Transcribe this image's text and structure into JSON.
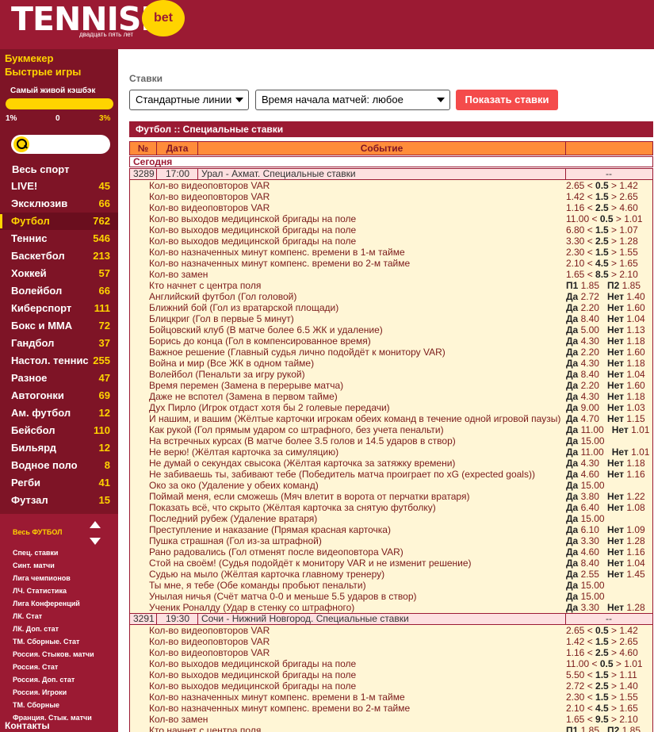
{
  "header": {
    "logo": "TENNISI",
    "logo_badge": "bet",
    "tagline": "двадцать пять лет"
  },
  "sidebar": {
    "links": [
      "Букмекер",
      "Быстрые игры"
    ],
    "cashback": {
      "title": "Самый живой кэшбэк",
      "min": "1%",
      "mid": "0",
      "max": "3%"
    },
    "search": {
      "placeholder": ""
    },
    "all_sport": "Весь спорт",
    "sports": [
      {
        "name": "LIVE!",
        "count": "45"
      },
      {
        "name": "Эксклюзив",
        "count": "66"
      },
      {
        "name": "Футбол",
        "count": "762",
        "active": true
      },
      {
        "name": "Теннис",
        "count": "546"
      },
      {
        "name": "Баскетбол",
        "count": "213"
      },
      {
        "name": "Хоккей",
        "count": "57"
      },
      {
        "name": "Волейбол",
        "count": "66"
      },
      {
        "name": "Киберспорт",
        "count": "111"
      },
      {
        "name": "Бокс и ММА",
        "count": "72"
      },
      {
        "name": "Гандбол",
        "count": "37"
      },
      {
        "name": "Настол. теннис",
        "count": "255"
      },
      {
        "name": "Разное",
        "count": "47"
      },
      {
        "name": "Автогонки",
        "count": "69"
      },
      {
        "name": "Ам. футбол",
        "count": "12"
      },
      {
        "name": "Бейсбол",
        "count": "110"
      },
      {
        "name": "Бильярд",
        "count": "12"
      },
      {
        "name": "Водное поло",
        "count": "8"
      },
      {
        "name": "Регби",
        "count": "41"
      },
      {
        "name": "Футзал",
        "count": "15"
      }
    ],
    "sub_title": "Весь ФУТБОЛ",
    "sub_items": [
      "Спец. ставки",
      "Синт. матчи",
      "Лига чемпионов",
      "ЛЧ. Статистика",
      "Лига Конференций",
      "ЛК. Стат",
      "ЛК. Доп. стат",
      "ТМ. Сборные. Стат",
      "Россия. Стыков. матчи",
      "Россия. Стат",
      "Россия. Доп. стат",
      "Россия. Игроки",
      "ТМ. Сборные",
      "Франция. Стык. матчи"
    ],
    "contacts": "Контакты"
  },
  "main": {
    "label": "Ставки",
    "select_lines": "Стандартные линии",
    "select_time": "Время начала матчей: любое",
    "show_button": "Показать ставки",
    "section_title": "Футбол :: Специальные ставки",
    "columns": [
      "№",
      "Дата",
      "Событие"
    ],
    "today": "Сегодня",
    "matches": [
      {
        "id": "3289",
        "time": "17:00",
        "title": "Урал - Ахмат. Специальные ставки",
        "dash": "--",
        "rows": [
          {
            "e": "Кол-во видеоповторов VAR",
            "o": "2.65 < <b>0.5</b> > 1.42"
          },
          {
            "e": "Кол-во видеоповторов VAR",
            "o": "1.42 < <b>1.5</b> > 2.65"
          },
          {
            "e": "Кол-во видеоповторов VAR",
            "o": "1.16 < <b>2.5</b> > 4.60"
          },
          {
            "e": "Кол-во выходов медицинской бригады на поле",
            "o": "11.00 < <b>0.5</b> > 1.01"
          },
          {
            "e": "Кол-во выходов медицинской бригады на поле",
            "o": "6.80 < <b>1.5</b> > 1.07"
          },
          {
            "e": "Кол-во выходов медицинской бригады на поле",
            "o": "3.30 < <b>2.5</b> > 1.28"
          },
          {
            "e": "Кол-во назначенных минут компенс. времени в 1-м тайме",
            "o": "2.30 < <b>1.5</b> > 1.55"
          },
          {
            "e": "Кол-во назначенных минут компенс. времени во 2-м тайме",
            "o": "2.10 < <b>4.5</b> > 1.65"
          },
          {
            "e": "Кол-во замен",
            "o": "1.65 < <b>8.5</b> > 2.10"
          },
          {
            "e": "Кто начнет с центра поля",
            "o": "<b>П1</b> 1.85 &nbsp;&nbsp;<b>П2</b> 1.85"
          },
          {
            "e": "Английский футбол (Гол головой)",
            "o": "<b>Да</b> 2.72 &nbsp;&nbsp;<b>Нет</b> 1.40"
          },
          {
            "e": "Ближний бой (Гол из вратарской площади)",
            "o": "<b>Да</b> 2.20 &nbsp;&nbsp;<b>Нет</b> 1.60"
          },
          {
            "e": "Блицкриг (Гол в первые 5 минут)",
            "o": "<b>Да</b> 8.40 &nbsp;&nbsp;<b>Нет</b> 1.04"
          },
          {
            "e": "Бойцовский клуб (В матче более 6.5 ЖК и удаление)",
            "o": "<b>Да</b> 5.00 &nbsp;&nbsp;<b>Нет</b> 1.13"
          },
          {
            "e": "Борись до конца (Гол в компенсированное время)",
            "o": "<b>Да</b> 4.30 &nbsp;&nbsp;<b>Нет</b> 1.18"
          },
          {
            "e": "Важное решение (Главный судья лично подойдёт к монитору VAR)",
            "o": "<b>Да</b> 2.20 &nbsp;&nbsp;<b>Нет</b> 1.60"
          },
          {
            "e": "Война и мир (Все ЖК в одном тайме)",
            "o": "<b>Да</b> 4.30 &nbsp;&nbsp;<b>Нет</b> 1.18"
          },
          {
            "e": "Волейбол (Пенальти за игру рукой)",
            "o": "<b>Да</b> 8.40 &nbsp;&nbsp;<b>Нет</b> 1.04"
          },
          {
            "e": "Время перемен (Замена в перерыве матча)",
            "o": "<b>Да</b> 2.20 &nbsp;&nbsp;<b>Нет</b> 1.60"
          },
          {
            "e": "Даже не вспотел (Замена в первом тайме)",
            "o": "<b>Да</b> 4.30 &nbsp;&nbsp;<b>Нет</b> 1.18"
          },
          {
            "e": "Дух Пирло (Игрок отдаст хотя бы 2 голевые передачи)",
            "o": "<b>Да</b> 9.00 &nbsp;&nbsp;<b>Нет</b> 1.03"
          },
          {
            "e": "И нашим, и вашим (Жёлтые карточки игрокам обеих команд в течение одной игровой паузы)",
            "o": "<b>Да</b> 4.70 &nbsp;&nbsp;<b>Нет</b> 1.15"
          },
          {
            "e": "Как рукой (Гол прямым ударом со штрафного, без учета пенальти)",
            "o": "<b>Да</b> 11.00 &nbsp;&nbsp;<b>Нет</b> 1.01"
          },
          {
            "e": "На встречных курсах (В матче более 3.5 голов и 14.5 ударов в створ)",
            "o": "<b>Да</b> 15.00"
          },
          {
            "e": "Не верю! (Жёлтая карточка за симуляцию)",
            "o": "<b>Да</b> 11.00 &nbsp;&nbsp;<b>Нет</b> 1.01"
          },
          {
            "e": "Не думай о секундах свысока (Жёлтая карточка за затяжку времени)",
            "o": "<b>Да</b> 4.30 &nbsp;&nbsp;<b>Нет</b> 1.18"
          },
          {
            "e": "Не забиваешь ты, забивают тебе (Победитель матча проиграет по xG (expected goals))",
            "o": "<b>Да</b> 4.60 &nbsp;&nbsp;<b>Нет</b> 1.16"
          },
          {
            "e": "Око за око (Удаление у обеих команд)",
            "o": "<b>Да</b> 15.00"
          },
          {
            "e": "Поймай меня, если сможешь (Мяч влетит в ворота от перчатки вратаря)",
            "o": "<b>Да</b> 3.80 &nbsp;&nbsp;<b>Нет</b> 1.22"
          },
          {
            "e": "Показать всё, что скрыто (Жёлтая карточка за снятую футболку)",
            "o": "<b>Да</b> 6.40 &nbsp;&nbsp;<b>Нет</b> 1.08"
          },
          {
            "e": "Последний рубеж (Удаление вратаря)",
            "o": "<b>Да</b> 15.00"
          },
          {
            "e": "Преступление и наказание (Прямая красная карточка)",
            "o": "<b>Да</b> 6.10 &nbsp;&nbsp;<b>Нет</b> 1.09"
          },
          {
            "e": "Пушка страшная (Гол из-за штрафной)",
            "o": "<b>Да</b> 3.30 &nbsp;&nbsp;<b>Нет</b> 1.28"
          },
          {
            "e": "Рано радовались (Гол отменят после видеоповтора VAR)",
            "o": "<b>Да</b> 4.60 &nbsp;&nbsp;<b>Нет</b> 1.16"
          },
          {
            "e": "Стой на своём! (Судья подойдёт к монитору VAR и не изменит решение)",
            "o": "<b>Да</b> 8.40 &nbsp;&nbsp;<b>Нет</b> 1.04"
          },
          {
            "e": "Судью на мыло (Жёлтая карточка главному тренеру)",
            "o": "<b>Да</b> 2.55 &nbsp;&nbsp;<b>Нет</b> 1.45"
          },
          {
            "e": "Ты мне, я тебе (Обе команды пробьют пенальти)",
            "o": "<b>Да</b> 15.00"
          },
          {
            "e": "Унылая ничья (Счёт матча 0-0 и меньше 5.5 ударов в створ)",
            "o": "<b>Да</b> 15.00"
          },
          {
            "e": "Ученик Роналду (Удар в стенку со штрафного)",
            "o": "<b>Да</b> 3.30 &nbsp;&nbsp;<b>Нет</b> 1.28"
          }
        ]
      },
      {
        "id": "3291",
        "time": "19:30",
        "title": "Сочи - Нижний Новгород. Специальные ставки",
        "dash": "--",
        "rows": [
          {
            "e": "Кол-во видеоповторов VAR",
            "o": "2.65 < <b>0.5</b> > 1.42"
          },
          {
            "e": "Кол-во видеоповторов VAR",
            "o": "1.42 < <b>1.5</b> > 2.65"
          },
          {
            "e": "Кол-во видеоповторов VAR",
            "o": "1.16 < <b>2.5</b> > 4.60"
          },
          {
            "e": "Кол-во выходов медицинской бригады на поле",
            "o": "11.00 < <b>0.5</b> > 1.01"
          },
          {
            "e": "Кол-во выходов медицинской бригады на поле",
            "o": "5.50 < <b>1.5</b> > 1.11"
          },
          {
            "e": "Кол-во выходов медицинской бригады на поле",
            "o": "2.72 < <b>2.5</b> > 1.40"
          },
          {
            "e": "Кол-во назначенных минут компенс. времени в 1-м тайме",
            "o": "2.30 < <b>1.5</b> > 1.55"
          },
          {
            "e": "Кол-во назначенных минут компенс. времени во 2-м тайме",
            "o": "2.10 < <b>4.5</b> > 1.65"
          },
          {
            "e": "Кол-во замен",
            "o": "1.65 < <b>9.5</b> > 2.10"
          },
          {
            "e": "Кто начнет с центра поля",
            "o": "<b>П1</b> 1.85 &nbsp;&nbsp;<b>П2</b> 1.85"
          }
        ]
      }
    ]
  },
  "colors": {
    "brand": "#9b1a33",
    "sidebar": "#7e1426",
    "accent": "#ffd400",
    "header_row": "#ff8c3a",
    "button": "#f44b4b"
  }
}
